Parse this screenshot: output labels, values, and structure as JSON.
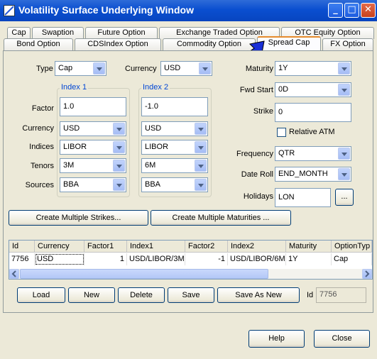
{
  "window": {
    "title": "Volatility Surface Underlying Window"
  },
  "tabs_row1": [
    "Cap",
    "Swaption",
    "Future Option",
    "Exchange Traded Option",
    "OTC Equity Option"
  ],
  "tabs_row2": [
    "Bond Option",
    "CDSIndex Option",
    "Commodity Option",
    "Spread Cap",
    "FX Option"
  ],
  "active_tab": "Spread Cap",
  "form": {
    "type_label": "Type",
    "type_value": "Cap",
    "currency_label": "Currency",
    "currency_value": "USD",
    "index1_title": "Index 1",
    "index2_title": "Index 2",
    "factor_label": "Factor",
    "factor1": "1.0",
    "factor2": "-1.0",
    "row_currency_label": "Currency",
    "currency1": "USD",
    "currency2": "USD",
    "indices_label": "Indices",
    "indices1": "LIBOR",
    "indices2": "LIBOR",
    "tenors_label": "Tenors",
    "tenors1": "3M",
    "tenors2": "6M",
    "sources_label": "Sources",
    "sources1": "BBA",
    "sources2": "BBA",
    "maturity_label": "Maturity",
    "maturity_value": "1Y",
    "fwdstart_label": "Fwd Start",
    "fwdstart_value": "0D",
    "strike_label": "Strike",
    "strike_value": "0",
    "relative_atm_label": "Relative ATM",
    "frequency_label": "Frequency",
    "frequency_value": "QTR",
    "dateroll_label": "Date Roll",
    "dateroll_value": "END_MONTH",
    "holidays_label": "Holidays",
    "holidays_value": "LON",
    "ellipsis_label": "..."
  },
  "buttons": {
    "create_strikes": "Create Multiple Strikes...",
    "create_maturities": "Create Multiple Maturities ...",
    "load": "Load",
    "new": "New",
    "delete": "Delete",
    "save": "Save",
    "save_as_new": "Save As New",
    "help": "Help",
    "close": "Close"
  },
  "table": {
    "columns": [
      "Id",
      "Currency",
      "Factor1",
      "Index1",
      "Factor2",
      "Index2",
      "Maturity",
      "OptionTyp"
    ],
    "rows": [
      [
        "7756",
        "USD",
        "1",
        "USD/LIBOR/3M",
        "-1",
        "USD/LIBOR/6M",
        "1Y",
        "Cap"
      ]
    ]
  },
  "id_label": "Id",
  "id_value": "7756",
  "colors": {
    "titlebar": "#0a4fd0",
    "group_title": "#0046d5",
    "active_tab_accent": "#e68b2c",
    "pointer_arrow": "#1a2fd6"
  },
  "icons": {
    "pointer": "blue-arrow-icon",
    "scroll_left": "chevron-left-icon",
    "scroll_right": "chevron-right-icon"
  }
}
